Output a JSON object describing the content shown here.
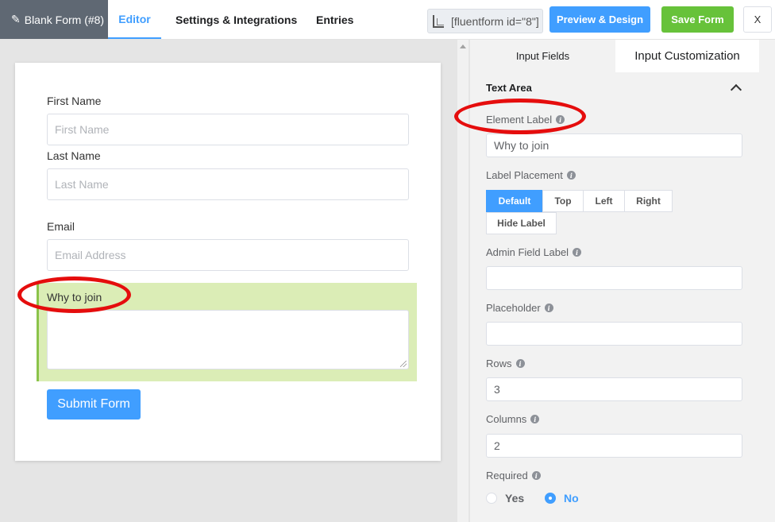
{
  "header": {
    "form_title": "Blank Form (#8)",
    "tabs": [
      "Editor",
      "Settings & Integrations",
      "Entries"
    ],
    "shortcode": "[fluentform id=\"8\"]",
    "preview_label": "Preview & Design",
    "save_label": "Save Form",
    "close_label": "X",
    "accent_color": "#409eff",
    "save_color": "#67c23a"
  },
  "form": {
    "fields": [
      {
        "label": "First Name",
        "placeholder": "First Name"
      },
      {
        "label": "Last Name",
        "placeholder": "Last Name"
      },
      {
        "label": "Email",
        "placeholder": "Email Address"
      }
    ],
    "textarea_label": "Why to join",
    "submit_label": "Submit Form",
    "selected_color": "#dbedb6"
  },
  "panel": {
    "tabs": [
      "Input Fields",
      "Input Customization"
    ],
    "section_title": "Text Area",
    "element_label": {
      "label": "Element Label",
      "value": "Why to join"
    },
    "label_placement": {
      "label": "Label Placement",
      "options": [
        "Default",
        "Top",
        "Left",
        "Right",
        "Hide Label"
      ],
      "selected": "Default"
    },
    "admin_field_label": {
      "label": "Admin Field Label",
      "value": ""
    },
    "placeholder": {
      "label": "Placeholder",
      "value": ""
    },
    "rows": {
      "label": "Rows",
      "value": "3"
    },
    "columns": {
      "label": "Columns",
      "value": "2"
    },
    "required": {
      "label": "Required",
      "options": [
        "Yes",
        "No"
      ],
      "selected": "No"
    }
  },
  "annotation_color": "#e50d0d"
}
